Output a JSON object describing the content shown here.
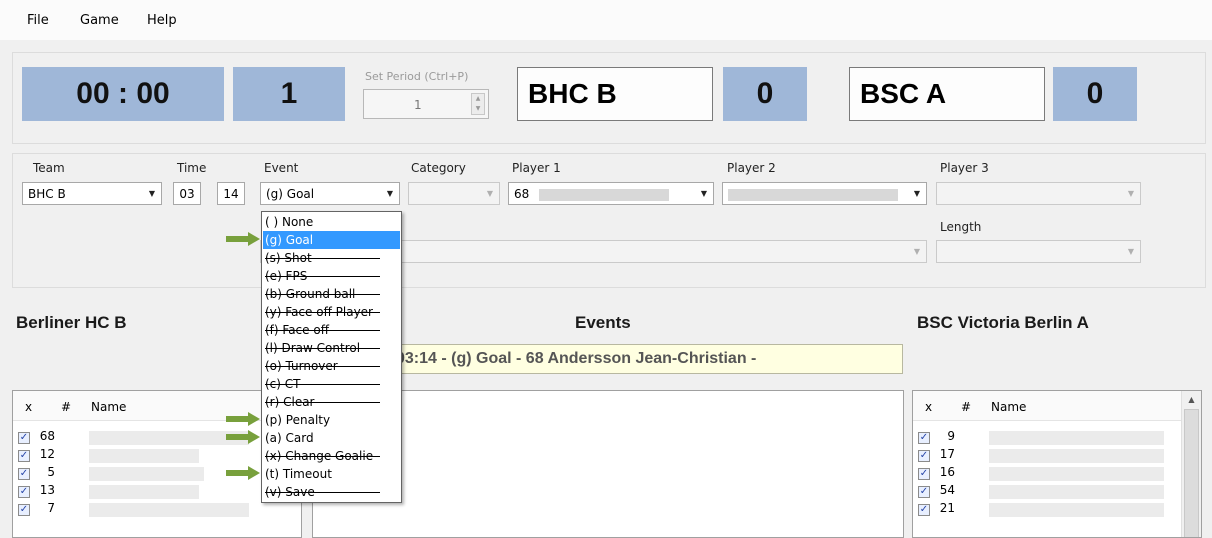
{
  "menu": [
    "File",
    "Game",
    "Help"
  ],
  "scoreboard": {
    "clock": "00 : 00",
    "period": "1",
    "set_period_label": "Set Period (Ctrl+P)",
    "set_period_value": "1",
    "home_team": "BHC B",
    "home_score": "0",
    "away_team": "BSC A",
    "away_score": "0",
    "accent_color": "#9fb7d8"
  },
  "event_form": {
    "labels": {
      "team": "Team",
      "time": "Time",
      "event": "Event",
      "category": "Category",
      "player1": "Player 1",
      "player2": "Player 2",
      "player3": "Player 3",
      "length": "Length"
    },
    "team_value": "BHC B",
    "time_min": "03",
    "time_sec": "14",
    "event_value": "(g) Goal",
    "player1_value": "68"
  },
  "event_options": [
    {
      "label": "( ) None",
      "struck": false,
      "selected": false,
      "arrow": false
    },
    {
      "label": "(g) Goal",
      "struck": false,
      "selected": true,
      "arrow": true
    },
    {
      "label": "(s) Shot",
      "struck": true,
      "selected": false,
      "arrow": false
    },
    {
      "label": "(e) FPS",
      "struck": true,
      "selected": false,
      "arrow": false
    },
    {
      "label": "(b) Ground ball",
      "struck": true,
      "selected": false,
      "arrow": false
    },
    {
      "label": "(y) Face off Player",
      "struck": true,
      "selected": false,
      "arrow": false
    },
    {
      "label": "(f) Face off",
      "struck": true,
      "selected": false,
      "arrow": false
    },
    {
      "label": "(l) Draw Control",
      "struck": true,
      "selected": false,
      "arrow": false
    },
    {
      "label": "(o) Turnover",
      "struck": true,
      "selected": false,
      "arrow": false
    },
    {
      "label": "(c) CT",
      "struck": true,
      "selected": false,
      "arrow": false
    },
    {
      "label": "(r) Clear",
      "struck": true,
      "selected": false,
      "arrow": false
    },
    {
      "label": "(p) Penalty",
      "struck": false,
      "selected": false,
      "arrow": true
    },
    {
      "label": "(a) Card",
      "struck": false,
      "selected": false,
      "arrow": true
    },
    {
      "label": "(x) Change Goalie",
      "struck": true,
      "selected": false,
      "arrow": false
    },
    {
      "label": "(t) Timeout",
      "struck": false,
      "selected": false,
      "arrow": true
    },
    {
      "label": "(v) Save",
      "struck": true,
      "selected": false,
      "arrow": false
    }
  ],
  "home_roster": {
    "title": "Berliner HC B",
    "columns": [
      "x",
      "#",
      "Name"
    ],
    "numbers": [
      "68",
      "12",
      "5",
      "13",
      "7"
    ]
  },
  "events_panel": {
    "title": "Events",
    "last_event": "03:14 - (g) Goal - 68 Andersson Jean-Christian  -"
  },
  "away_roster": {
    "title": "BSC Victoria Berlin A",
    "columns": [
      "x",
      "#",
      "Name"
    ],
    "numbers": [
      "9",
      "17",
      "16",
      "54",
      "21"
    ]
  },
  "icons": {
    "dropdown_arrow": "▼",
    "checkmark": "✓",
    "spin_up": "▲",
    "spin_down": "▼",
    "scroll_up": "▲"
  },
  "arrow_color": "#78a03c"
}
